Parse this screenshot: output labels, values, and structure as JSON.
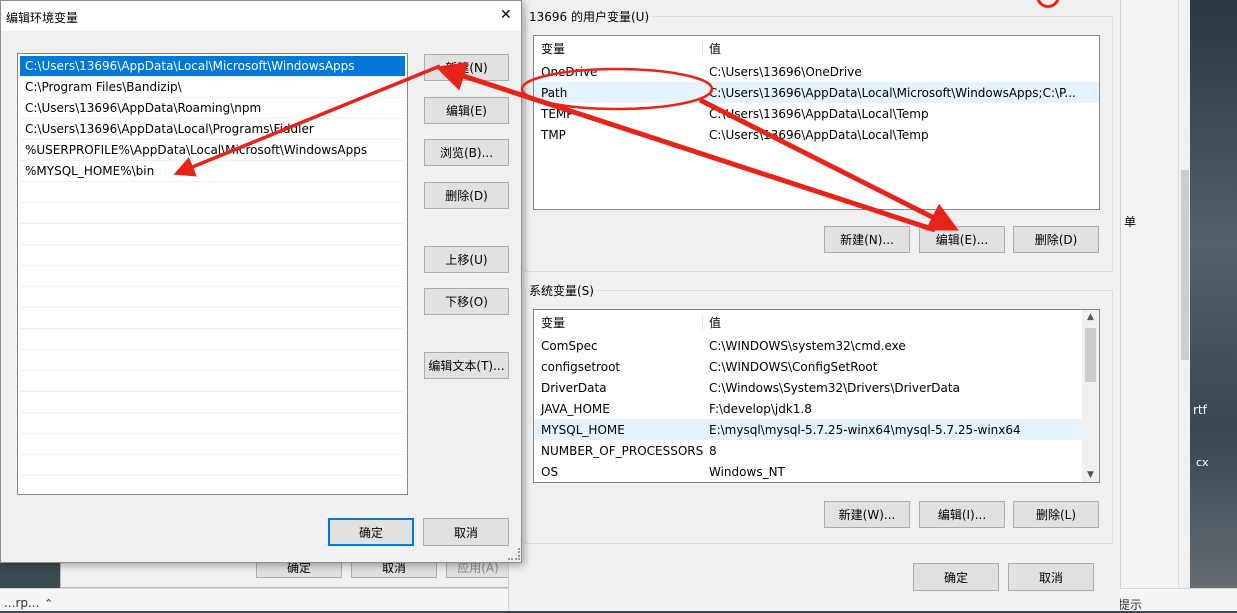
{
  "edit_dialog": {
    "title": "编辑环境变量",
    "close_glyph": "✕",
    "path_items": [
      "C:\\Users\\13696\\AppData\\Local\\Microsoft\\WindowsApps",
      "C:\\Program Files\\Bandizip\\",
      "C:\\Users\\13696\\AppData\\Roaming\\npm",
      "C:\\Users\\13696\\AppData\\Local\\Programs\\Fiddler",
      "%USERPROFILE%\\AppData\\Local\\Microsoft\\WindowsApps",
      "%MYSQL_HOME%\\bin"
    ],
    "buttons": {
      "new": "新建(N)",
      "edit": "编辑(E)",
      "browse": "浏览(B)...",
      "delete": "删除(D)",
      "move_up": "上移(U)",
      "move_down": "下移(O)",
      "edit_text": "编辑文本(T)...",
      "ok": "确定",
      "cancel": "取消"
    }
  },
  "env_dialog": {
    "user_section_label": "13696 的用户变量(U)",
    "columns": {
      "variable": "变量",
      "value": "值"
    },
    "user_vars": [
      {
        "name": "OneDrive",
        "value": "C:\\Users\\13696\\OneDrive"
      },
      {
        "name": "Path",
        "value": "C:\\Users\\13696\\AppData\\Local\\Microsoft\\WindowsApps;C:\\P..."
      },
      {
        "name": "TEMP",
        "value": "C:\\Users\\13696\\AppData\\Local\\Temp"
      },
      {
        "name": "TMP",
        "value": "C:\\Users\\13696\\AppData\\Local\\Temp"
      }
    ],
    "user_buttons": {
      "new": "新建(N)...",
      "edit": "编辑(E)...",
      "delete": "删除(D)"
    },
    "system_section_label": "系统变量(S)",
    "system_vars": [
      {
        "name": "ComSpec",
        "value": "C:\\WINDOWS\\system32\\cmd.exe"
      },
      {
        "name": "configsetroot",
        "value": "C:\\WINDOWS\\ConfigSetRoot"
      },
      {
        "name": "DriverData",
        "value": "C:\\Windows\\System32\\Drivers\\DriverData"
      },
      {
        "name": "JAVA_HOME",
        "value": "F:\\develop\\jdk1.8"
      },
      {
        "name": "MYSQL_HOME",
        "value": "E:\\mysql\\mysql-5.7.25-winx64\\mysql-5.7.25-winx64"
      },
      {
        "name": "NUMBER_OF_PROCESSORS",
        "value": "8"
      },
      {
        "name": "OS",
        "value": "Windows_NT"
      }
    ],
    "system_buttons": {
      "new": "新建(W)...",
      "edit": "编辑(I)...",
      "delete": "删除(L)"
    },
    "ok": "确定",
    "cancel": "取消"
  },
  "background": {
    "prop_buttons": [
      "确定",
      "取消",
      "应用(A)"
    ],
    "taskbar_text_left": "...rp...",
    "taskbar_text_right": "提示",
    "right_fragments": [
      "rtf",
      "cx",
      "单"
    ]
  },
  "colors": {
    "annotation_red": "#e8231a",
    "selection_blue": "#0078d7",
    "dialog_bg": "#f0f0f0"
  }
}
